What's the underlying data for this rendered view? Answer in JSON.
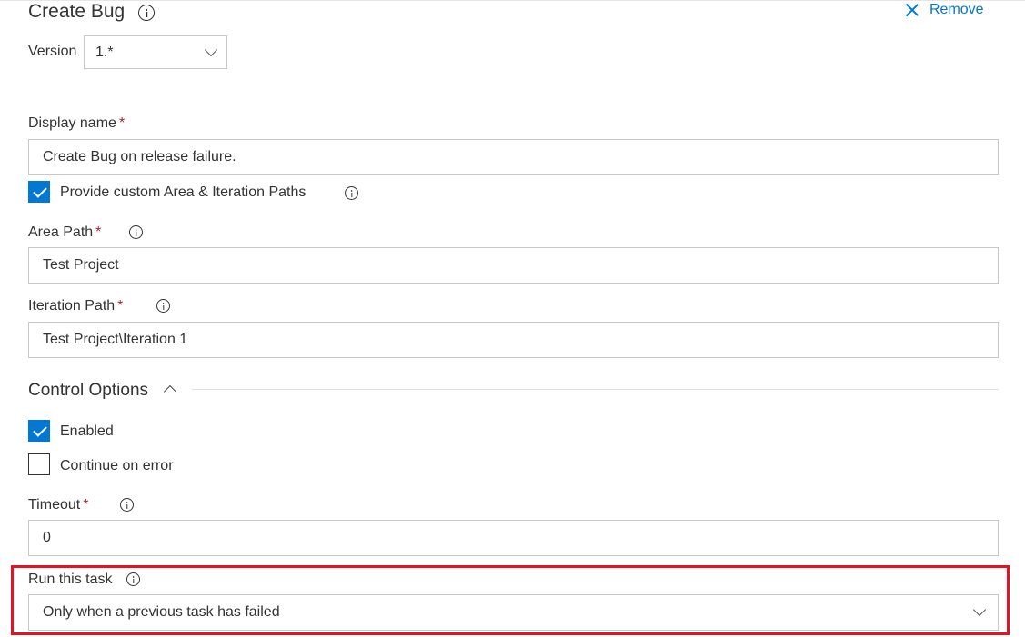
{
  "header": {
    "title": "Create Bug",
    "remove_label": "Remove"
  },
  "version": {
    "label": "Version",
    "value": "1.*"
  },
  "display_name": {
    "label": "Display name",
    "required_mark": "*",
    "value": "Create Bug on release failure."
  },
  "custom_paths": {
    "label": "Provide custom Area & Iteration Paths",
    "checked": true
  },
  "area_path": {
    "label": "Area Path",
    "required_mark": "*",
    "value": "Test Project"
  },
  "iteration_path": {
    "label": "Iteration Path",
    "required_mark": "*",
    "value": "Test Project\\Iteration 1"
  },
  "control_options": {
    "title": "Control Options",
    "enabled": {
      "label": "Enabled",
      "checked": true
    },
    "continue_on_error": {
      "label": "Continue on error",
      "checked": false
    },
    "timeout": {
      "label": "Timeout",
      "required_mark": "*",
      "value": "0"
    },
    "run_this_task": {
      "label": "Run this task",
      "value": "Only when a previous task has failed"
    }
  },
  "colors": {
    "accent": "#0078d4",
    "required": "#a4262c",
    "highlight": "#e81123"
  },
  "icons": {
    "info": "info-icon",
    "close": "close-icon",
    "chevron_down": "chevron-down-icon",
    "chevron_up": "chevron-up-icon",
    "check": "checkmark-icon"
  }
}
